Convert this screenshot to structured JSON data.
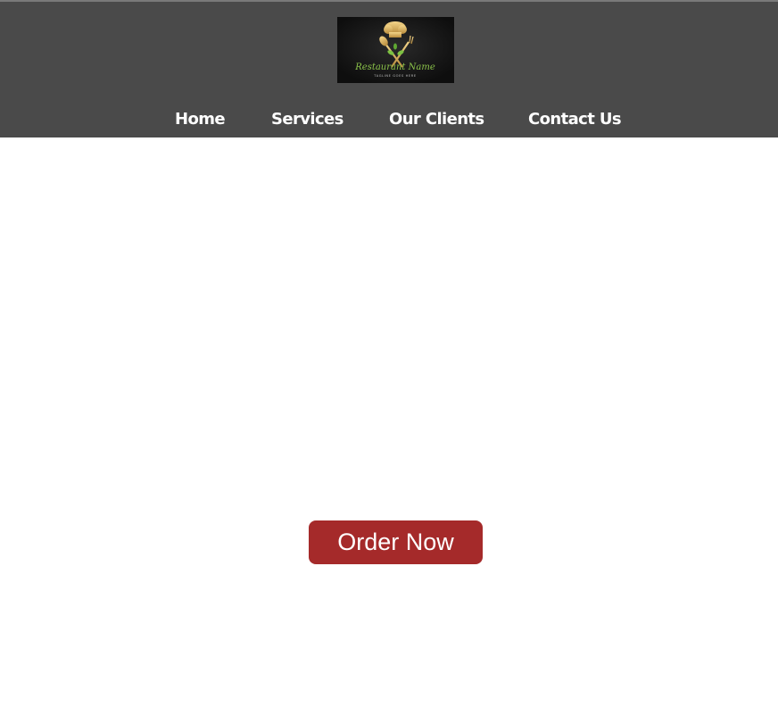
{
  "header": {
    "logo": {
      "brand_text": "Restaurant Name",
      "tagline_text": "TAGLINE GOES HERE",
      "icon": "chef-hat-spoon-fork-icon"
    },
    "nav": {
      "items": [
        {
          "label": "Home"
        },
        {
          "label": "Services"
        },
        {
          "label": "Our Clients"
        },
        {
          "label": "Contact Us"
        }
      ]
    }
  },
  "main": {
    "cta": {
      "label": "Order Now"
    }
  },
  "colors": {
    "header_bg": "#4a4a4a",
    "nav_text": "#ffffff",
    "cta_bg": "#a52a2a",
    "cta_text": "#ffffff",
    "page_bg": "#ffffff"
  }
}
